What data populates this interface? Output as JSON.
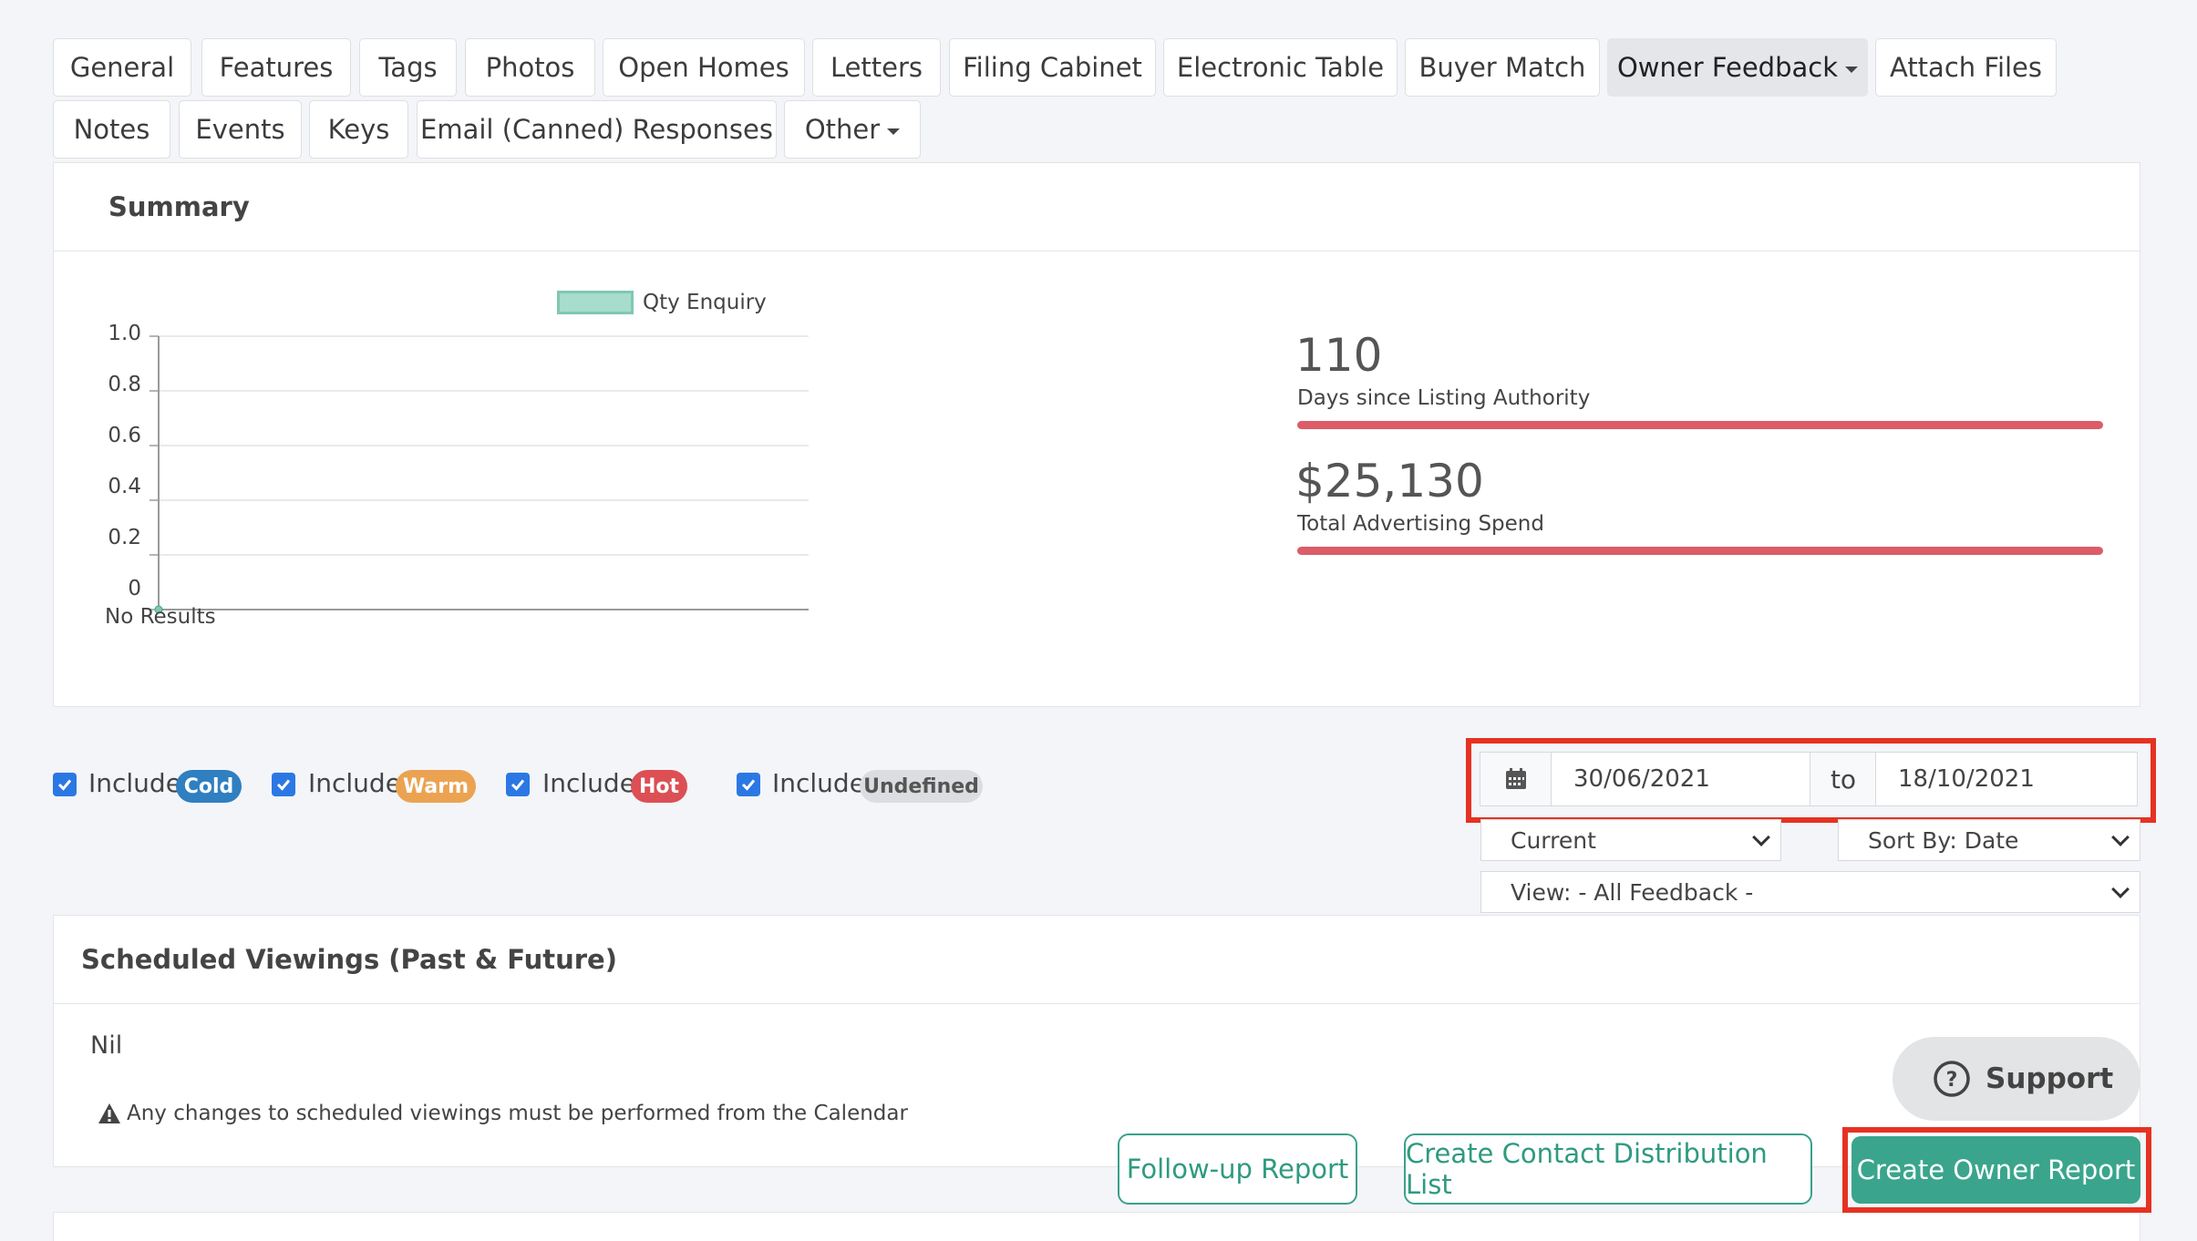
{
  "tabs_row1": [
    {
      "label": "General"
    },
    {
      "label": "Features"
    },
    {
      "label": "Tags"
    },
    {
      "label": "Photos"
    },
    {
      "label": "Open Homes"
    },
    {
      "label": "Letters"
    },
    {
      "label": "Filing Cabinet"
    },
    {
      "label": "Electronic Table"
    },
    {
      "label": "Buyer Match"
    },
    {
      "label": "Owner Feedback"
    },
    {
      "label": "Attach Files"
    }
  ],
  "tabs_row2": [
    {
      "label": "Notes"
    },
    {
      "label": "Events"
    },
    {
      "label": "Keys"
    },
    {
      "label": "Email (Canned) Responses"
    },
    {
      "label": "Other"
    }
  ],
  "summary": {
    "title": "Summary",
    "stats": [
      {
        "value": "110",
        "label": "Days since Listing Authority"
      },
      {
        "value": "$25,130",
        "label": "Total Advertising Spend"
      }
    ]
  },
  "chart_data": {
    "type": "line",
    "x": [
      "No Results"
    ],
    "series": [
      {
        "name": "Qty Enquiry",
        "values": [
          0
        ]
      }
    ],
    "yticks": [
      "1.0",
      "0.8",
      "0.6",
      "0.4",
      "0.2",
      "0"
    ],
    "ylim": [
      0,
      1.0
    ],
    "legend": "top",
    "grid": true,
    "colors": {
      "series": "#7fc8b3"
    }
  },
  "filters": {
    "include_label": "Include",
    "items": [
      {
        "badge": "Cold",
        "color": "#2f7fc1",
        "checked": true
      },
      {
        "badge": "Warm",
        "color": "#eba352",
        "checked": true
      },
      {
        "badge": "Hot",
        "color": "#dc4f55",
        "checked": true
      },
      {
        "badge": "Undefined",
        "color": "#dcdde0",
        "checked": true
      }
    ],
    "date_from": "30/06/2021",
    "date_sep": "to",
    "date_to": "18/10/2021",
    "status_select": "Current",
    "sort_select": "Sort By: Date",
    "view_select": "View: - All Feedback -"
  },
  "viewings": {
    "title": "Scheduled Viewings (Past & Future)",
    "value": "Nil",
    "notice": "Any changes to scheduled viewings must be performed from the Calendar"
  },
  "actions": {
    "follow_up": "Follow-up Report",
    "distribution": "Create Contact Distribution List",
    "owner_report": "Create Owner Report",
    "support": "Support"
  }
}
